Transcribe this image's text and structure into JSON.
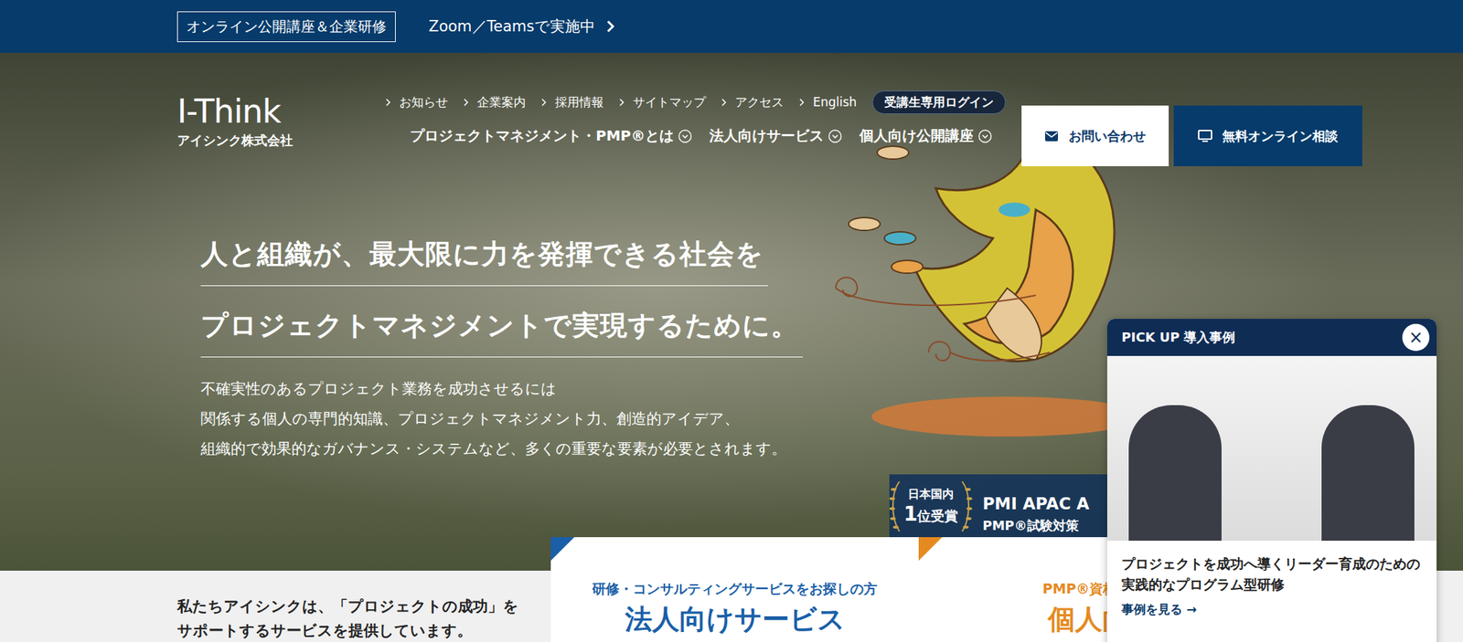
{
  "topBar": {
    "badge": "オンライン公開講座＆企業研修",
    "link": "Zoom／Teamsで実施中"
  },
  "logo": {
    "name": "I-Think",
    "company": "アイシンク株式会社"
  },
  "utilityLinks": [
    "お知らせ",
    "企業案内",
    "採用情報",
    "サイトマップ",
    "アクセス",
    "English"
  ],
  "loginButton": "受講生専用ログイン",
  "mainNav": [
    {
      "label": "プロジェクトマネジメント・PMP®とは",
      "expanded": false
    },
    {
      "label": "法人向けサービス",
      "expanded": false
    },
    {
      "label": "個人向け公開講座",
      "expanded": false
    }
  ],
  "ctaButtons": [
    {
      "label": "お問い合わせ",
      "kind": "light"
    },
    {
      "label": "無料オンライン相談",
      "kind": "dark"
    }
  ],
  "hero": {
    "headlines": [
      "人と組織が、最大限に力を発揮できる社会を",
      "プロジェクトマネジメントで実現するために。"
    ],
    "paragraph": [
      "不確実性のあるプロジェクト業務を成功させるには",
      "関係する個人の専門的知識、プロジェクトマネジメント力、創造的アイデア、",
      "組織的で効果的なガバナンス・システムなど、多くの重要な要素が必要とされます。"
    ]
  },
  "award": {
    "rankPrefix": "日本国内",
    "rankNumber": "1",
    "rankSuffix": "位受賞",
    "title": "PMI APAC A",
    "subtitle": "PMP®試験対策"
  },
  "intro": [
    "私たちアイシンクは、「プロジェクトの成功」を",
    "サポートするサービスを提供しています。"
  ],
  "serviceCards": [
    {
      "caption": "研修・コンサルティングサービスをお探しの方",
      "title": "法人向けサービス",
      "color": "#1a5fa8"
    },
    {
      "caption": "PMP®資格・PDU",
      "title": "個人向け",
      "color": "#e58a1f"
    }
  ],
  "popup": {
    "heading": "PICK UP 導入事例",
    "close": "×",
    "description": "プロジェクトを成功へ導くリーダー育成のための実践的なプログラム型研修",
    "link": "事例を見る →"
  }
}
